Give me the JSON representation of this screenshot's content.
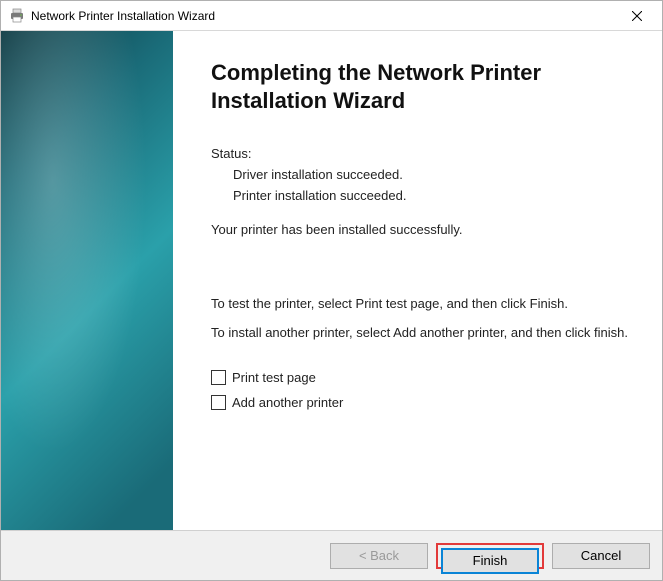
{
  "window": {
    "title": "Network Printer Installation Wizard"
  },
  "main": {
    "heading": "Completing the Network Printer Installation Wizard",
    "status_label": "Status:",
    "status_line1": "Driver installation succeeded.",
    "status_line2": "Printer installation succeeded.",
    "success_msg": "Your printer has been installed successfully.",
    "test_msg": "To test the printer, select Print test page, and then click Finish.",
    "another_msg": "To install another printer, select Add another printer, and then click finish.",
    "check_print": "Print test page",
    "check_add": "Add another printer"
  },
  "footer": {
    "back": "< Back",
    "finish": "Finish",
    "cancel": "Cancel"
  }
}
